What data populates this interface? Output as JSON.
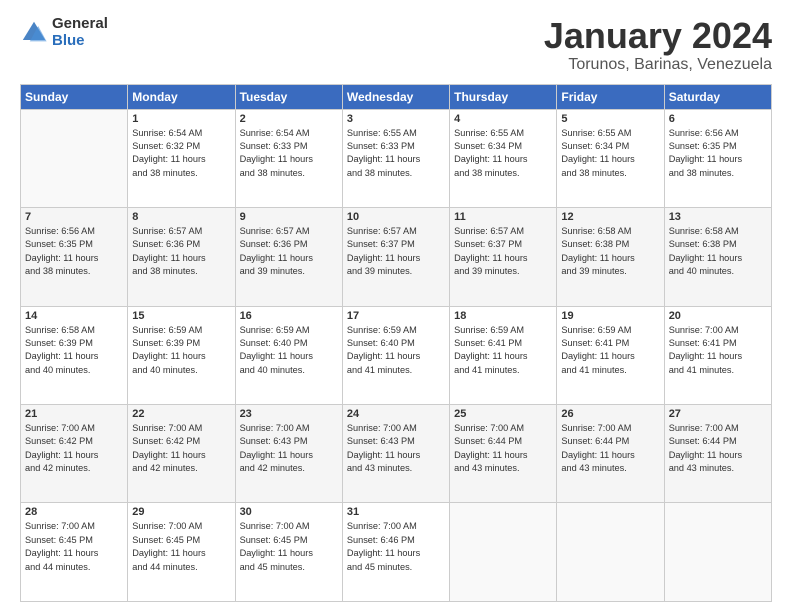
{
  "header": {
    "logo_general": "General",
    "logo_blue": "Blue",
    "title": "January 2024",
    "subtitle": "Torunos, Barinas, Venezuela"
  },
  "days_of_week": [
    "Sunday",
    "Monday",
    "Tuesday",
    "Wednesday",
    "Thursday",
    "Friday",
    "Saturday"
  ],
  "weeks": [
    [
      {
        "num": "",
        "sunrise": "",
        "sunset": "",
        "daylight": ""
      },
      {
        "num": "1",
        "sunrise": "Sunrise: 6:54 AM",
        "sunset": "Sunset: 6:32 PM",
        "daylight": "Daylight: 11 hours and 38 minutes."
      },
      {
        "num": "2",
        "sunrise": "Sunrise: 6:54 AM",
        "sunset": "Sunset: 6:33 PM",
        "daylight": "Daylight: 11 hours and 38 minutes."
      },
      {
        "num": "3",
        "sunrise": "Sunrise: 6:55 AM",
        "sunset": "Sunset: 6:33 PM",
        "daylight": "Daylight: 11 hours and 38 minutes."
      },
      {
        "num": "4",
        "sunrise": "Sunrise: 6:55 AM",
        "sunset": "Sunset: 6:34 PM",
        "daylight": "Daylight: 11 hours and 38 minutes."
      },
      {
        "num": "5",
        "sunrise": "Sunrise: 6:55 AM",
        "sunset": "Sunset: 6:34 PM",
        "daylight": "Daylight: 11 hours and 38 minutes."
      },
      {
        "num": "6",
        "sunrise": "Sunrise: 6:56 AM",
        "sunset": "Sunset: 6:35 PM",
        "daylight": "Daylight: 11 hours and 38 minutes."
      }
    ],
    [
      {
        "num": "7",
        "sunrise": "Sunrise: 6:56 AM",
        "sunset": "Sunset: 6:35 PM",
        "daylight": "Daylight: 11 hours and 38 minutes."
      },
      {
        "num": "8",
        "sunrise": "Sunrise: 6:57 AM",
        "sunset": "Sunset: 6:36 PM",
        "daylight": "Daylight: 11 hours and 38 minutes."
      },
      {
        "num": "9",
        "sunrise": "Sunrise: 6:57 AM",
        "sunset": "Sunset: 6:36 PM",
        "daylight": "Daylight: 11 hours and 39 minutes."
      },
      {
        "num": "10",
        "sunrise": "Sunrise: 6:57 AM",
        "sunset": "Sunset: 6:37 PM",
        "daylight": "Daylight: 11 hours and 39 minutes."
      },
      {
        "num": "11",
        "sunrise": "Sunrise: 6:57 AM",
        "sunset": "Sunset: 6:37 PM",
        "daylight": "Daylight: 11 hours and 39 minutes."
      },
      {
        "num": "12",
        "sunrise": "Sunrise: 6:58 AM",
        "sunset": "Sunset: 6:38 PM",
        "daylight": "Daylight: 11 hours and 39 minutes."
      },
      {
        "num": "13",
        "sunrise": "Sunrise: 6:58 AM",
        "sunset": "Sunset: 6:38 PM",
        "daylight": "Daylight: 11 hours and 40 minutes."
      }
    ],
    [
      {
        "num": "14",
        "sunrise": "Sunrise: 6:58 AM",
        "sunset": "Sunset: 6:39 PM",
        "daylight": "Daylight: 11 hours and 40 minutes."
      },
      {
        "num": "15",
        "sunrise": "Sunrise: 6:59 AM",
        "sunset": "Sunset: 6:39 PM",
        "daylight": "Daylight: 11 hours and 40 minutes."
      },
      {
        "num": "16",
        "sunrise": "Sunrise: 6:59 AM",
        "sunset": "Sunset: 6:40 PM",
        "daylight": "Daylight: 11 hours and 40 minutes."
      },
      {
        "num": "17",
        "sunrise": "Sunrise: 6:59 AM",
        "sunset": "Sunset: 6:40 PM",
        "daylight": "Daylight: 11 hours and 41 minutes."
      },
      {
        "num": "18",
        "sunrise": "Sunrise: 6:59 AM",
        "sunset": "Sunset: 6:41 PM",
        "daylight": "Daylight: 11 hours and 41 minutes."
      },
      {
        "num": "19",
        "sunrise": "Sunrise: 6:59 AM",
        "sunset": "Sunset: 6:41 PM",
        "daylight": "Daylight: 11 hours and 41 minutes."
      },
      {
        "num": "20",
        "sunrise": "Sunrise: 7:00 AM",
        "sunset": "Sunset: 6:41 PM",
        "daylight": "Daylight: 11 hours and 41 minutes."
      }
    ],
    [
      {
        "num": "21",
        "sunrise": "Sunrise: 7:00 AM",
        "sunset": "Sunset: 6:42 PM",
        "daylight": "Daylight: 11 hours and 42 minutes."
      },
      {
        "num": "22",
        "sunrise": "Sunrise: 7:00 AM",
        "sunset": "Sunset: 6:42 PM",
        "daylight": "Daylight: 11 hours and 42 minutes."
      },
      {
        "num": "23",
        "sunrise": "Sunrise: 7:00 AM",
        "sunset": "Sunset: 6:43 PM",
        "daylight": "Daylight: 11 hours and 42 minutes."
      },
      {
        "num": "24",
        "sunrise": "Sunrise: 7:00 AM",
        "sunset": "Sunset: 6:43 PM",
        "daylight": "Daylight: 11 hours and 43 minutes."
      },
      {
        "num": "25",
        "sunrise": "Sunrise: 7:00 AM",
        "sunset": "Sunset: 6:44 PM",
        "daylight": "Daylight: 11 hours and 43 minutes."
      },
      {
        "num": "26",
        "sunrise": "Sunrise: 7:00 AM",
        "sunset": "Sunset: 6:44 PM",
        "daylight": "Daylight: 11 hours and 43 minutes."
      },
      {
        "num": "27",
        "sunrise": "Sunrise: 7:00 AM",
        "sunset": "Sunset: 6:44 PM",
        "daylight": "Daylight: 11 hours and 43 minutes."
      }
    ],
    [
      {
        "num": "28",
        "sunrise": "Sunrise: 7:00 AM",
        "sunset": "Sunset: 6:45 PM",
        "daylight": "Daylight: 11 hours and 44 minutes."
      },
      {
        "num": "29",
        "sunrise": "Sunrise: 7:00 AM",
        "sunset": "Sunset: 6:45 PM",
        "daylight": "Daylight: 11 hours and 44 minutes."
      },
      {
        "num": "30",
        "sunrise": "Sunrise: 7:00 AM",
        "sunset": "Sunset: 6:45 PM",
        "daylight": "Daylight: 11 hours and 45 minutes."
      },
      {
        "num": "31",
        "sunrise": "Sunrise: 7:00 AM",
        "sunset": "Sunset: 6:46 PM",
        "daylight": "Daylight: 11 hours and 45 minutes."
      },
      {
        "num": "",
        "sunrise": "",
        "sunset": "",
        "daylight": ""
      },
      {
        "num": "",
        "sunrise": "",
        "sunset": "",
        "daylight": ""
      },
      {
        "num": "",
        "sunrise": "",
        "sunset": "",
        "daylight": ""
      }
    ]
  ]
}
